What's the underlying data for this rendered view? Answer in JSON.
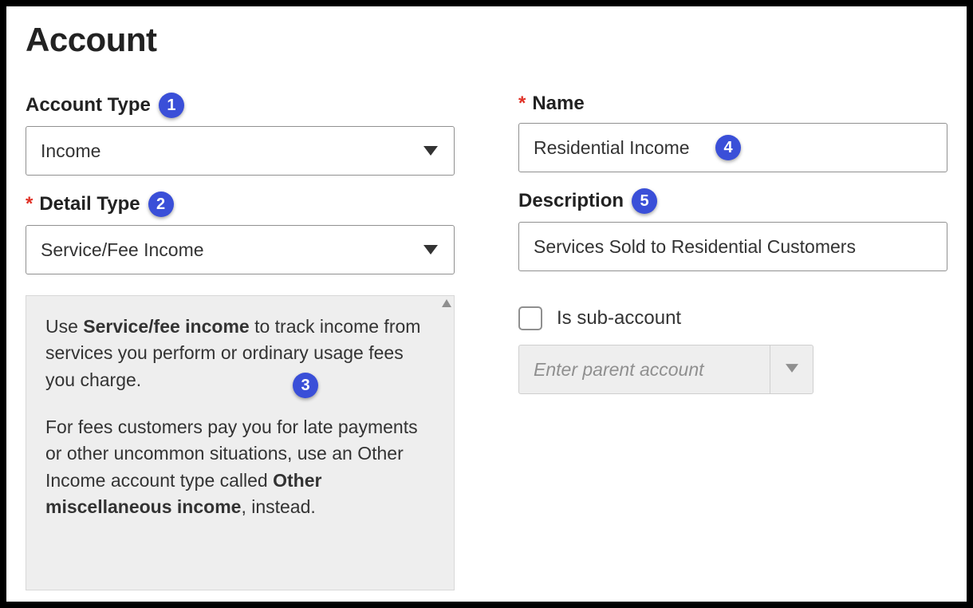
{
  "title": "Account",
  "badges": {
    "b1": "1",
    "b2": "2",
    "b3": "3",
    "b4": "4",
    "b5": "5"
  },
  "left": {
    "accountType": {
      "label": "Account Type",
      "value": "Income"
    },
    "detailType": {
      "label": "Detail Type",
      "value": "Service/Fee Income"
    },
    "help": {
      "p1_pre": "Use ",
      "p1_bold": "Service/fee income",
      "p1_post": " to track income from services you perform or ordinary usage fees you charge.",
      "p2_pre": "For fees customers pay you for late payments or other uncommon situations, use an Other Income account type called ",
      "p2_bold": "Other miscellaneous income",
      "p2_post": ", instead."
    }
  },
  "right": {
    "name": {
      "label": "Name",
      "value": "Residential Income"
    },
    "description": {
      "label": "Description",
      "value": "Services Sold to Residential Customers"
    },
    "subaccount": {
      "label": "Is sub-account",
      "checked": false
    },
    "parent": {
      "placeholder": "Enter parent account"
    }
  }
}
